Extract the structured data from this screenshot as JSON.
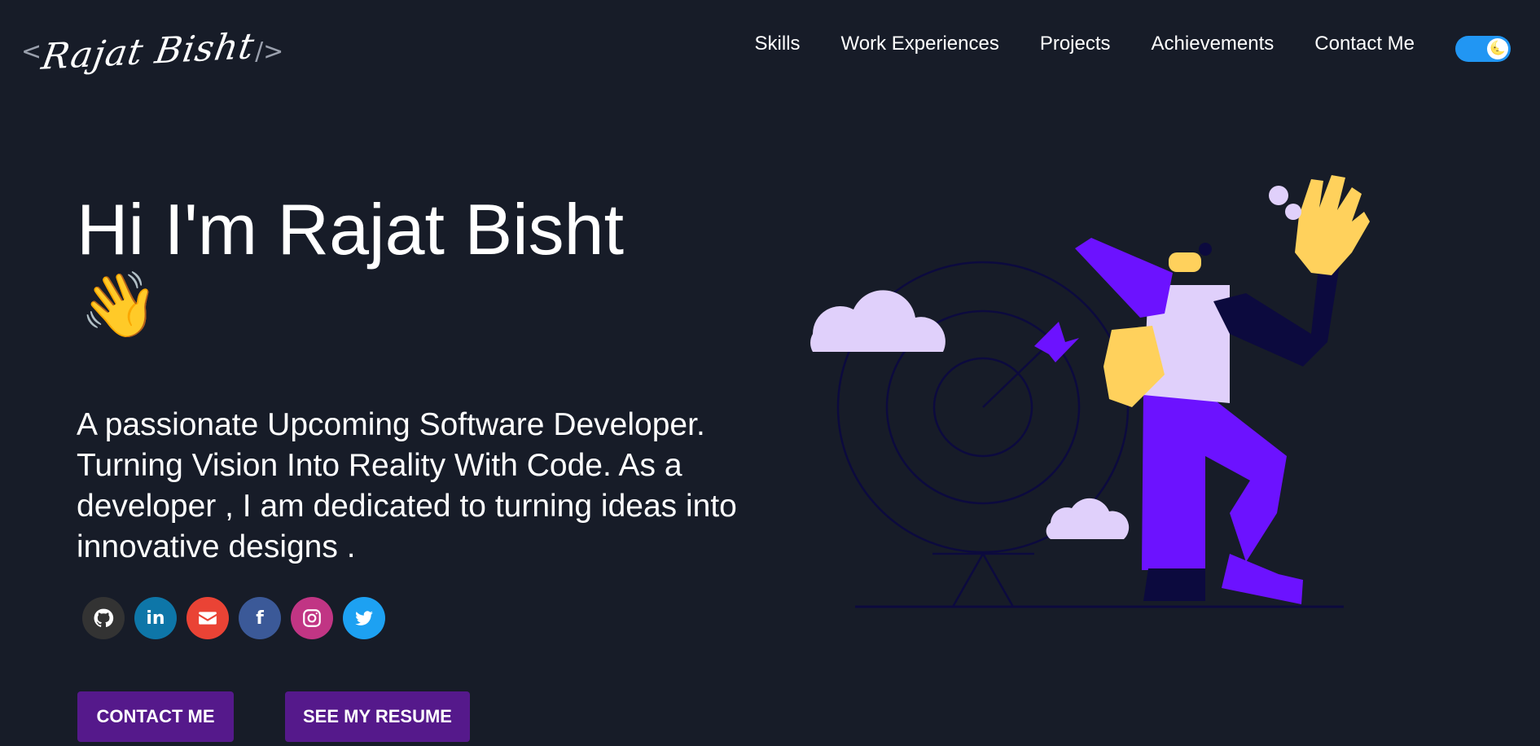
{
  "header": {
    "logo_open": "<",
    "logo_name": "Rajat Bisht",
    "logo_close": "/>",
    "nav": [
      {
        "label": "Skills"
      },
      {
        "label": "Work Experiences"
      },
      {
        "label": "Projects"
      },
      {
        "label": "Achievements"
      },
      {
        "label": "Contact Me"
      }
    ],
    "theme_toggle": {
      "state": "dark",
      "icon": "moon-icon"
    }
  },
  "hero": {
    "title": "Hi I'm Rajat Bisht",
    "wave_emoji": "👋",
    "tagline": "A passionate Upcoming Software Developer. Turning Vision Into Reality With Code. As a developer , I am dedicated to turning ideas into innovative designs .",
    "socials": [
      {
        "name": "github",
        "color": "#333333",
        "glyph": "github-icon"
      },
      {
        "name": "linkedin",
        "color": "#0e76a8",
        "glyph": "in"
      },
      {
        "name": "email",
        "color": "#ea4335",
        "glyph": "mail-icon"
      },
      {
        "name": "facebook",
        "color": "#3b5998",
        "glyph": "f"
      },
      {
        "name": "instagram",
        "color": "#c13584",
        "glyph": "instagram-icon"
      },
      {
        "name": "twitter",
        "color": "#1da1f2",
        "glyph": "twitter-icon"
      }
    ],
    "buttons": {
      "contact": "CONTACT ME",
      "resume": "SEE MY RESUME"
    }
  },
  "colors": {
    "background": "#171c28",
    "button": "#55198b",
    "toggle": "#2196f3",
    "accent_purple": "#6c12ff",
    "accent_yellow": "#ffd15c",
    "accent_lavender": "#e0d0fb"
  }
}
